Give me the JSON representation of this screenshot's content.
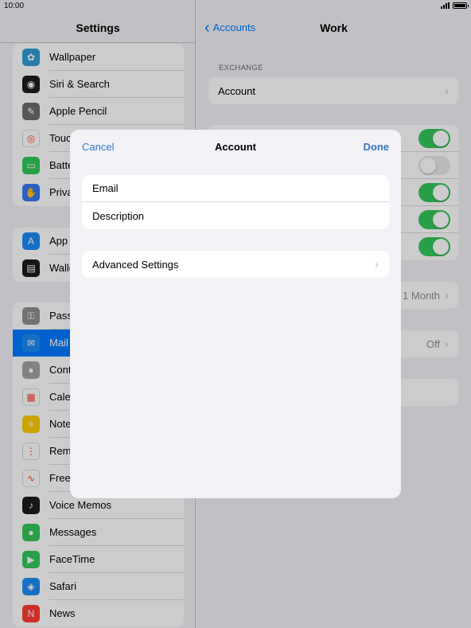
{
  "status": {
    "time": "10:00"
  },
  "left": {
    "title": "Settings",
    "groups": [
      [
        {
          "label": "Wallpaper",
          "icon": "wallpaper-icon",
          "color": "#2f9bd6"
        },
        {
          "label": "Siri & Search",
          "icon": "siri-icon",
          "color": "#1c1c1e"
        },
        {
          "label": "Apple Pencil",
          "icon": "pencil-icon",
          "color": "#6d6d72"
        },
        {
          "label": "Touc",
          "icon": "touch-id-icon",
          "color": "#ffffff"
        },
        {
          "label": "Batte",
          "icon": "battery-icon",
          "color": "#34c759"
        },
        {
          "label": "Priva",
          "icon": "privacy-hand-icon",
          "color": "#3478f6"
        }
      ],
      [
        {
          "label": "App",
          "icon": "app-store-icon",
          "color": "#1b8cf5"
        },
        {
          "label": "Walle",
          "icon": "wallet-icon",
          "color": "#1c1c1e"
        }
      ],
      [
        {
          "label": "Pass",
          "icon": "passwords-key-icon",
          "color": "#8e8e93"
        },
        {
          "label": "Mail",
          "icon": "mail-icon",
          "color": "#1b8cf5"
        },
        {
          "label": "Cont",
          "icon": "contacts-icon",
          "color": "#a3a3a8"
        },
        {
          "label": "Cale",
          "icon": "calendar-icon",
          "color": "#ffffff"
        },
        {
          "label": "Note",
          "icon": "notes-icon",
          "color": "#ffcc00"
        },
        {
          "label": "Rem",
          "icon": "reminders-icon",
          "color": "#ffffff"
        },
        {
          "label": "Free",
          "icon": "freeform-icon",
          "color": "#ffffff"
        },
        {
          "label": "Voice Memos",
          "icon": "voice-memos-icon",
          "color": "#1c1c1e"
        },
        {
          "label": "Messages",
          "icon": "messages-icon",
          "color": "#34c759"
        },
        {
          "label": "FaceTime",
          "icon": "facetime-icon",
          "color": "#34c759"
        },
        {
          "label": "Safari",
          "icon": "safari-icon",
          "color": "#1b8cf5"
        },
        {
          "label": "News",
          "icon": "news-icon",
          "color": "#ff3b30"
        }
      ]
    ]
  },
  "right": {
    "back_label": "Accounts",
    "title": "Work",
    "section_label": "EXCHANGE",
    "account_row": "Account",
    "toggles": [
      true,
      false,
      true,
      true,
      true
    ],
    "mail_days_value": "1 Month",
    "auto_reply_value": "Off"
  },
  "modal": {
    "cancel_label": "Cancel",
    "title": "Account",
    "done_label": "Done",
    "email_placeholder": "Email",
    "description_placeholder": "Description",
    "advanced_label": "Advanced Settings"
  },
  "colors": {
    "accent": "#3478c5",
    "toggle_on": "#34c759",
    "selected": "#007aff"
  }
}
